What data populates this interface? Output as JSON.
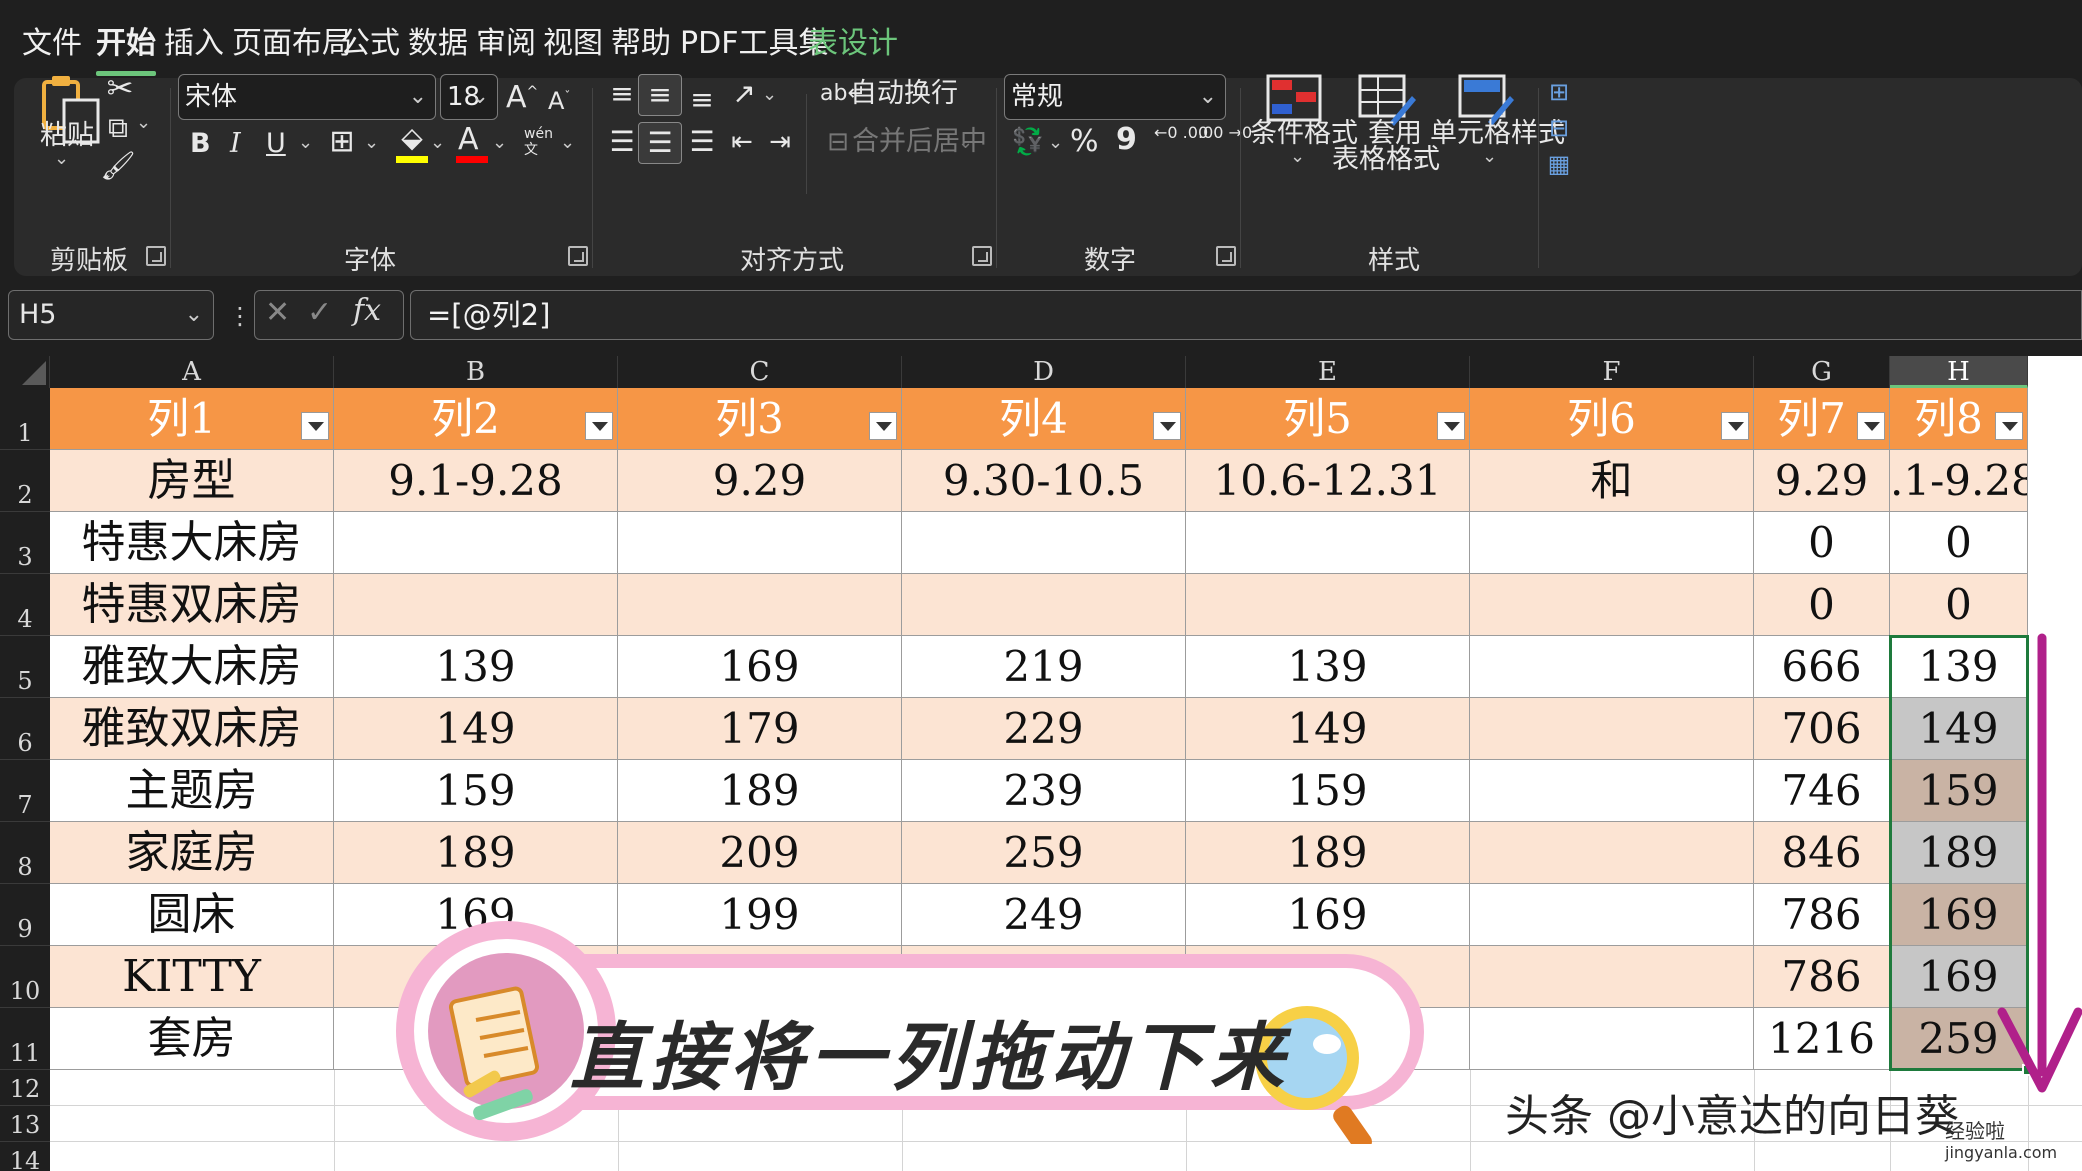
{
  "menu": {
    "items": [
      "文件",
      "开始",
      "插入",
      "页面布局",
      "公式",
      "数据",
      "审阅",
      "视图",
      "帮助",
      "PDF工具集",
      "表设计"
    ],
    "active": "开始",
    "contextual": "表设计"
  },
  "ribbon": {
    "clipboard": {
      "paste": "粘贴",
      "label": "剪贴板"
    },
    "font": {
      "name": "宋体",
      "size": "18",
      "bold": "B",
      "italic": "I",
      "underline": "U",
      "font_color_glyph": "A",
      "phonetic": "wén",
      "phonetic_sub": "文",
      "grow": "A",
      "shrink": "A",
      "label": "字体"
    },
    "alignment": {
      "wrap": "自动换行",
      "merge": "合并后居中",
      "label": "对齐方式"
    },
    "number": {
      "format": "常规",
      "percent": "%",
      "comma": "9",
      "inc_dec": "←0 .00",
      "dec_dec": ".00 →0",
      "label": "数字"
    },
    "styles": {
      "conditional": "条件格式",
      "table_fmt_1": "套用",
      "table_fmt_2": "表格格式",
      "cell_style": "单元格样式",
      "label": "样式"
    }
  },
  "formula_bar": {
    "name_box": "H5",
    "fx": "fx",
    "formula": "=[@列2]"
  },
  "grid": {
    "columns": [
      "A",
      "B",
      "C",
      "D",
      "E",
      "F",
      "G",
      "H"
    ],
    "selected_column": "H",
    "row_numbers": [
      "1",
      "2",
      "3",
      "4",
      "5",
      "6",
      "7",
      "8",
      "9",
      "10",
      "11",
      "12",
      "13",
      "14"
    ],
    "header_row": [
      "列1",
      "列2",
      "列3",
      "列4",
      "列5",
      "列6",
      "列7",
      "列8"
    ],
    "rows": [
      [
        "房型",
        "9.1-9.28",
        "9.29",
        "9.30-10.5",
        "10.6-12.31",
        "和",
        "9.29",
        ".1-9.28"
      ],
      [
        "特惠大床房",
        "",
        "",
        "",
        "",
        "",
        "0",
        "0"
      ],
      [
        "特惠双床房",
        "",
        "",
        "",
        "",
        "",
        "0",
        "0"
      ],
      [
        "雅致大床房",
        "139",
        "169",
        "219",
        "139",
        "",
        "666",
        "139"
      ],
      [
        "雅致双床房",
        "149",
        "179",
        "229",
        "149",
        "",
        "706",
        "149"
      ],
      [
        "主题房",
        "159",
        "189",
        "239",
        "159",
        "",
        "746",
        "159"
      ],
      [
        "家庭房",
        "189",
        "209",
        "259",
        "189",
        "",
        "846",
        "189"
      ],
      [
        "圆床",
        "169",
        "199",
        "249",
        "169",
        "",
        "786",
        "169"
      ],
      [
        "KITTY",
        "",
        "",
        "",
        "",
        "",
        "786",
        "169"
      ],
      [
        "套房",
        "",
        "",
        "",
        "",
        "",
        "1216",
        "259"
      ]
    ]
  },
  "overlay": {
    "banner_text": "直接将一列拖动下来",
    "watermark": "头条 @小意达的向日葵",
    "site_mark": "经验啦",
    "site_url": "jingyanla.com",
    "arrow_color": "#b0208a"
  }
}
